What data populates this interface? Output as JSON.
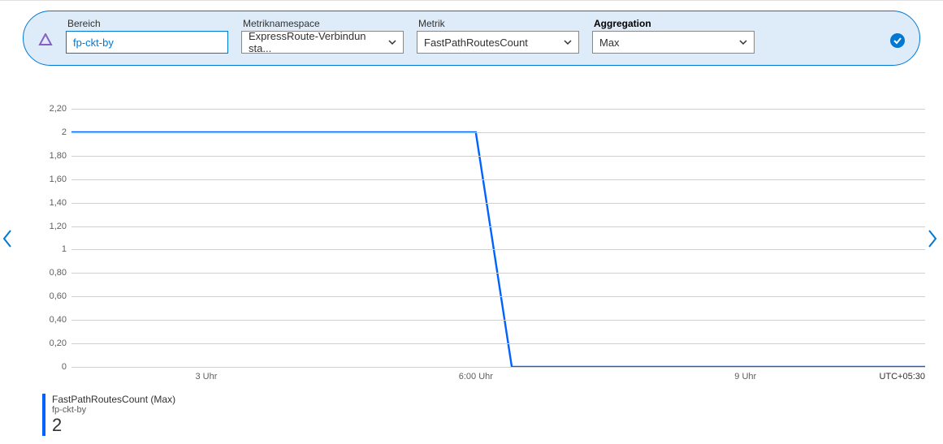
{
  "filter": {
    "scope_label": "Bereich",
    "scope_value": "fp-ckt-by",
    "namespace_label": "Metriknamespace",
    "namespace_value": "ExpressRoute-Verbindun sta...",
    "metric_label": "Metrik",
    "metric_value": "FastPathRoutesCount",
    "aggregation_label": "Aggregation",
    "aggregation_value": "Max"
  },
  "chart_data": {
    "type": "line",
    "ylabel": "",
    "xlabel": "",
    "ylim": [
      0,
      2.2
    ],
    "y_ticks": [
      "2,20",
      "2",
      "1,80",
      "1,60",
      "1,40",
      "1,20",
      "1",
      "0,80",
      "0,60",
      "0,40",
      "0,20",
      "0"
    ],
    "x_ticks": [
      "3 Uhr",
      "6:00 Uhr",
      "9 Uhr"
    ],
    "timezone": "UTC+05:30",
    "series": [
      {
        "name": "FastPathRoutesCount (Max)",
        "resource": "fp-ckt-by",
        "x_hours": [
          1.5,
          6.0,
          6.4,
          11.0
        ],
        "values": [
          2,
          2,
          0,
          0
        ]
      }
    ]
  },
  "legend": {
    "title": "FastPathRoutesCount (Max)",
    "subtitle": "fp-ckt-by",
    "value": "2"
  }
}
